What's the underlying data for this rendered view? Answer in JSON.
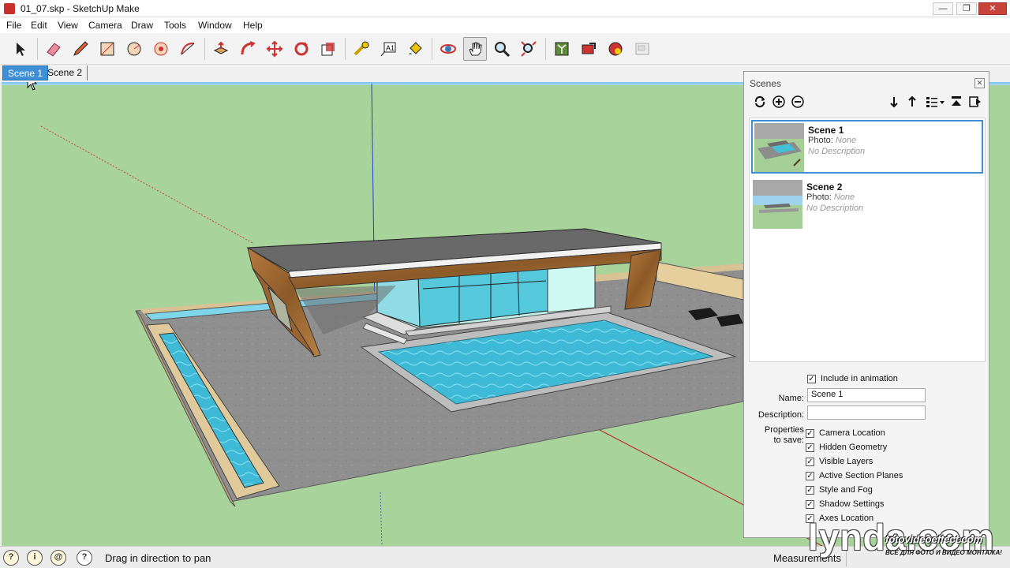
{
  "window": {
    "title": "01_07.skp - SketchUp Make",
    "minimize": "—",
    "restore": "❐",
    "close": "✕"
  },
  "menu": [
    "File",
    "Edit",
    "View",
    "Camera",
    "Draw",
    "Tools",
    "Window",
    "Help"
  ],
  "toolbar": {
    "tools": [
      {
        "name": "select-tool-icon"
      },
      {
        "name": "eraser-tool-icon"
      },
      {
        "name": "pencil-tool-icon"
      },
      {
        "name": "rectangle-tool-icon"
      },
      {
        "name": "circle-tool-icon"
      },
      {
        "name": "polygon-tool-icon"
      },
      {
        "name": "arc-tool-icon"
      },
      {
        "name": "push-pull-tool-icon"
      },
      {
        "name": "follow-me-tool-icon"
      },
      {
        "name": "move-tool-icon"
      },
      {
        "name": "rotate-tool-icon"
      },
      {
        "name": "scale-tool-icon"
      },
      {
        "name": "tape-measure-tool-icon"
      },
      {
        "name": "text-tool-icon"
      },
      {
        "name": "paint-bucket-tool-icon"
      },
      {
        "name": "orbit-tool-icon"
      },
      {
        "name": "pan-tool-icon"
      },
      {
        "name": "zoom-tool-icon"
      },
      {
        "name": "zoom-extents-tool-icon"
      },
      {
        "name": "3d-warehouse-icon"
      },
      {
        "name": "share-model-icon"
      },
      {
        "name": "extension-warehouse-icon"
      },
      {
        "name": "layout-icon"
      }
    ],
    "active_tool": "pan-tool-icon"
  },
  "scene_tabs": [
    {
      "label": "Scene 1",
      "active": true
    },
    {
      "label": "Scene 2",
      "active": false
    }
  ],
  "status": {
    "help_text": "Drag in direction to pan",
    "measurements_label": "Measurements",
    "icons": [
      "geo-location-icon",
      "credits-icon",
      "user-account-icon",
      "help-icon"
    ]
  },
  "scenes_panel": {
    "title": "Scenes",
    "close_label": "✕",
    "buttons": [
      "update-scene-icon",
      "add-scene-icon",
      "delete-scene-icon",
      "move-scene-down-icon",
      "move-scene-up-icon",
      "view-options-icon",
      "hide-details-icon",
      "expand-icon"
    ],
    "photo_label": "Photo:",
    "photo_none": "None",
    "no_description": "No Description",
    "scenes": [
      {
        "name": "Scene 1",
        "selected": true
      },
      {
        "name": "Scene 2",
        "selected": false
      }
    ],
    "include_in_animation": "Include in animation",
    "name_label": "Name:",
    "name_value": "Scene 1",
    "description_label": "Description:",
    "description_value": "",
    "properties_label_1": "Properties",
    "properties_label_2": "to save:",
    "properties": [
      {
        "label": "Camera Location",
        "checked": true
      },
      {
        "label": "Hidden Geometry",
        "checked": true
      },
      {
        "label": "Visible Layers",
        "checked": true
      },
      {
        "label": "Active Section Planes",
        "checked": true
      },
      {
        "label": "Style and Fog",
        "checked": true
      },
      {
        "label": "Shadow Settings",
        "checked": true
      },
      {
        "label": "Axes Location",
        "checked": true
      }
    ]
  },
  "watermark": {
    "brand": "lynda.com",
    "site": "fotovideoeffect.com",
    "tagline": "ВСЕ ДЛЯ ФОТО И ВИДЕО МОНТАЖА!"
  },
  "colors": {
    "sky": "#9fd2ec",
    "ground": "#a9d39a",
    "pool": "#3dbdd6",
    "deck": "#8d8d8d",
    "wood": "#a06a33",
    "accent": "#3d8fd6"
  }
}
